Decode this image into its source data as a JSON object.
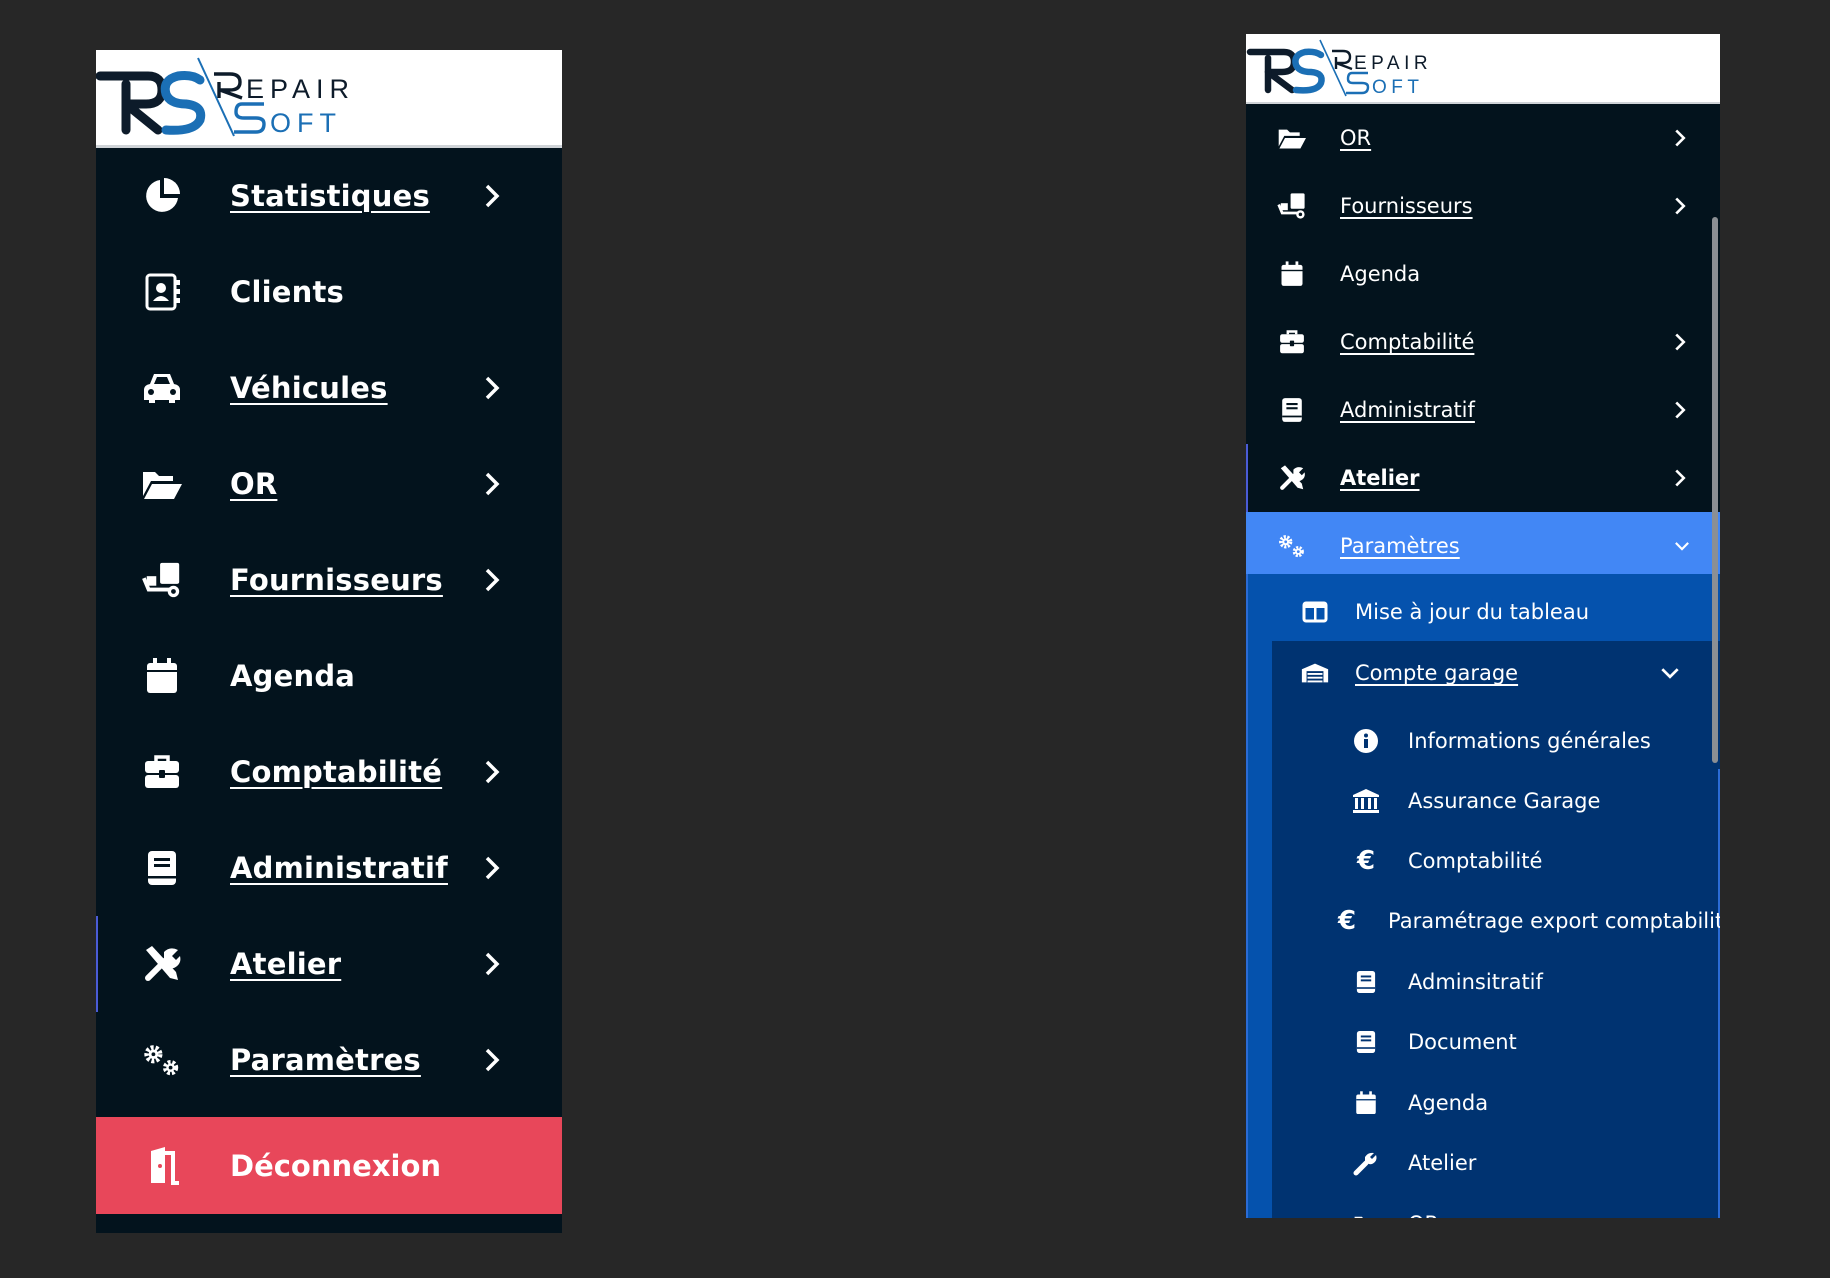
{
  "logo": {
    "line1": "REPAIR",
    "line2": "SOFT",
    "monogram": "RS"
  },
  "left_menu": {
    "items": [
      {
        "label": "Statistiques",
        "icon": "pie-chart-icon",
        "chevron": true,
        "underline": true
      },
      {
        "label": "Clients",
        "icon": "contact-book-icon",
        "chevron": false,
        "underline": false
      },
      {
        "label": "Véhicules",
        "icon": "car-icon",
        "chevron": true,
        "underline": true
      },
      {
        "label": "OR",
        "icon": "folder-open-icon",
        "chevron": true,
        "underline": true
      },
      {
        "label": "Fournisseurs",
        "icon": "dolly-icon",
        "chevron": true,
        "underline": true
      },
      {
        "label": "Agenda",
        "icon": "calendar-icon",
        "chevron": false,
        "underline": false
      },
      {
        "label": "Comptabilité",
        "icon": "briefcase-icon",
        "chevron": true,
        "underline": true
      },
      {
        "label": "Administratif",
        "icon": "book-icon",
        "chevron": true,
        "underline": true
      },
      {
        "label": "Atelier",
        "icon": "tools-icon",
        "chevron": true,
        "underline": true,
        "active": true
      },
      {
        "label": "Paramètres",
        "icon": "gears-icon",
        "chevron": true,
        "underline": true
      }
    ],
    "logout": {
      "label": "Déconnexion",
      "icon": "door-exit-icon"
    }
  },
  "right_menu": {
    "items": [
      {
        "label": "OR",
        "icon": "folder-open-icon",
        "chevron": "right"
      },
      {
        "label": "Fournisseurs",
        "icon": "dolly-icon",
        "chevron": "right"
      },
      {
        "label": "Agenda",
        "icon": "calendar-icon",
        "chevron": "none"
      },
      {
        "label": "Comptabilité",
        "icon": "briefcase-icon",
        "chevron": "right"
      },
      {
        "label": "Administratif",
        "icon": "book-icon",
        "chevron": "right"
      },
      {
        "label": "Atelier",
        "icon": "tools-icon",
        "chevron": "right",
        "active": true
      },
      {
        "label": "Paramètres",
        "icon": "gears-icon",
        "chevron": "down",
        "open": true
      }
    ],
    "parametres_sub": [
      {
        "label": "Mise à jour du tableau",
        "icon": "columns-icon"
      },
      {
        "label": "Compte garage",
        "icon": "garage-icon",
        "chevron": "down"
      }
    ],
    "compte_garage_sub": [
      {
        "label": "Informations générales",
        "icon": "info-icon"
      },
      {
        "label": "Assurance Garage",
        "icon": "bank-icon"
      },
      {
        "label": "Comptabilité",
        "icon": "euro-icon"
      },
      {
        "label": "Paramétrage export comptabilité",
        "icon": "euro-icon"
      },
      {
        "label": "Adminsitratif",
        "icon": "book-icon"
      },
      {
        "label": "Document",
        "icon": "book-icon"
      },
      {
        "label": "Agenda",
        "icon": "calendar-icon"
      },
      {
        "label": "Atelier",
        "icon": "wrench-icon"
      },
      {
        "label": "OR",
        "icon": "folder-open-icon"
      }
    ]
  },
  "colors": {
    "background": "#272727",
    "sidebar": "#03131d",
    "logout": "#e8475a",
    "open_item": "#4287f5",
    "sub_level1": "#0552ad",
    "sub_level2": "#003371"
  }
}
